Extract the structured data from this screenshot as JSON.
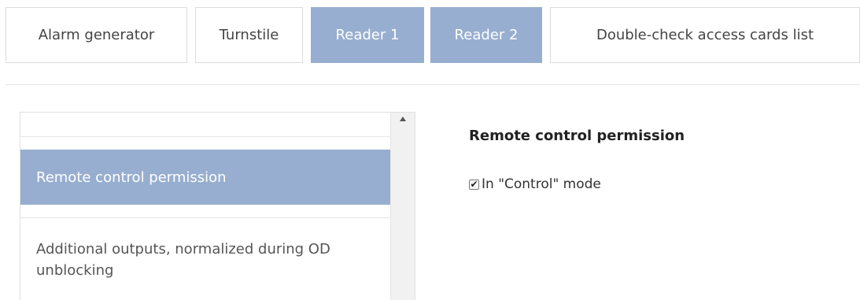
{
  "tabs": [
    {
      "label": "Alarm generator"
    },
    {
      "label": "Turnstile"
    },
    {
      "label": "Reader 1"
    },
    {
      "label": "Reader 2",
      "active": true
    },
    {
      "label": "Double-check access cards list"
    }
  ],
  "list": {
    "items": [
      {
        "label": "Remote control permission",
        "selected": true
      },
      {
        "label": "Additional outputs, normalized during OD unblocking"
      }
    ]
  },
  "settings": {
    "title": "Remote control permission",
    "checkbox": {
      "label": "In \"Control\" mode",
      "checked": true,
      "mark": "✔"
    }
  },
  "colors": {
    "accent": "#98aed0",
    "border": "#dcdcdc"
  }
}
